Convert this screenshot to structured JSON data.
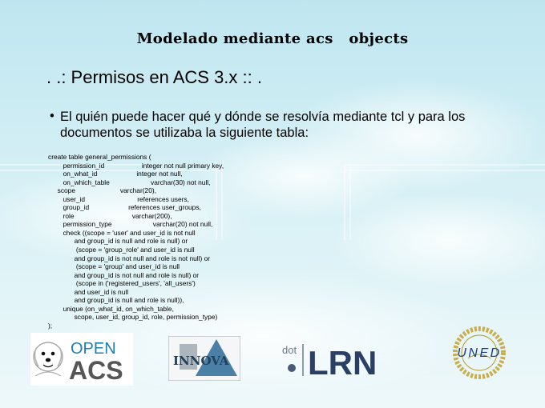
{
  "header": {
    "title": "Modelado mediante acs   objects"
  },
  "slide": {
    "heading": ". .: Permisos en ACS 3.x :: .",
    "bullet_symbol": "•",
    "bullet": "El quién puede hacer qué y dónde se resolvía mediante tcl y para los documentos se utilizaba la siguiente tabla:",
    "code_lines": [
      "create table general_permissions (",
      "        permission_id                    integer not null primary key,",
      "        on_what_id                     integer not null,",
      "        on_which_table                      varchar(30) not null,",
      "     scope                        varchar(20),",
      "        user_id                            references users,",
      "        group_id                     references user_groups,",
      "        role                               varchar(200),",
      "        permission_type                      varchar(20) not null,",
      "        check ((scope = 'user' and user_id is not null",
      "              and group_id is null and role is null) or",
      "               (scope = 'group_role' and user_id is null",
      "              and group_id is not null and role is not null) or",
      "               (scope = 'group' and user_id is null",
      "              and group_id is not null and role is null) or",
      "               (scope in ('registered_users', 'all_users')",
      "              and user_id is null",
      "              and group_id is null and role is null)),",
      "        unique (on_what_id, on_which_table,",
      "              scope, user_id, group_id, role, permission_type)",
      ");"
    ]
  },
  "logos": {
    "openacs": {
      "top": "OPEN",
      "bottom": "ACS"
    },
    "innova": {
      "text": "INNOVA"
    },
    "dotlrn": {
      "dot": "dot",
      "lrn": "LRN"
    },
    "uned": {
      "text": "UNED"
    }
  },
  "colors": {
    "background": "#c4e8f1",
    "openacs_blue": "#1d7fb5",
    "openacs_gray": "#555555",
    "innova_blue": "#2d6b98",
    "dotlrn_navy": "#2a3f66",
    "dotlrn_gray": "#6b7a8f",
    "uned_gold": "#b89a2e",
    "uned_blue": "#1b3a8c"
  }
}
